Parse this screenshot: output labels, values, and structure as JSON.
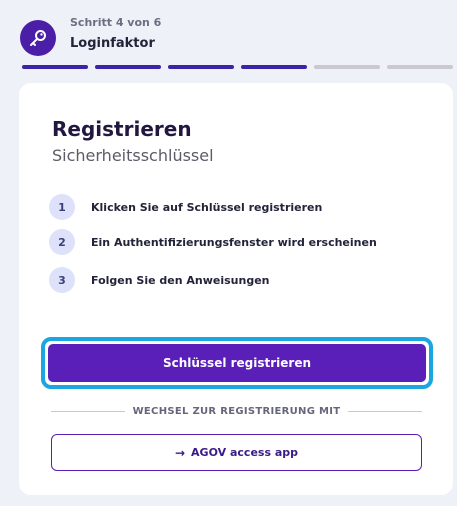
{
  "header": {
    "icon": "key-icon",
    "step_label": "Schritt 4 von 6",
    "title": "Loginfaktor"
  },
  "progress": {
    "total_segments": 6,
    "completed_segments": 4,
    "active_color": "#3d24a6",
    "inactive_color": "#c9c9cf"
  },
  "card": {
    "title": "Registrieren",
    "subtitle": "Sicherheitsschlüssel",
    "steps": [
      {
        "number": "1",
        "text": "Klicken Sie auf Schlüssel registrieren"
      },
      {
        "number": "2",
        "text": "Ein Authentifizierungsfenster wird erscheinen"
      },
      {
        "number": "3",
        "text": "Folgen Sie den Anweisungen"
      }
    ],
    "primary_button": "Schlüssel registrieren",
    "divider_label": "WECHSEL ZUR REGISTRIERUNG MIT",
    "secondary_button": {
      "icon": "arrow-right-icon",
      "arrow": "→",
      "label": "AGOV access app"
    }
  },
  "colors": {
    "primary": "#5a1fb9",
    "focus_ring": "#1aa6e0",
    "badge": "#4a1ea6"
  }
}
